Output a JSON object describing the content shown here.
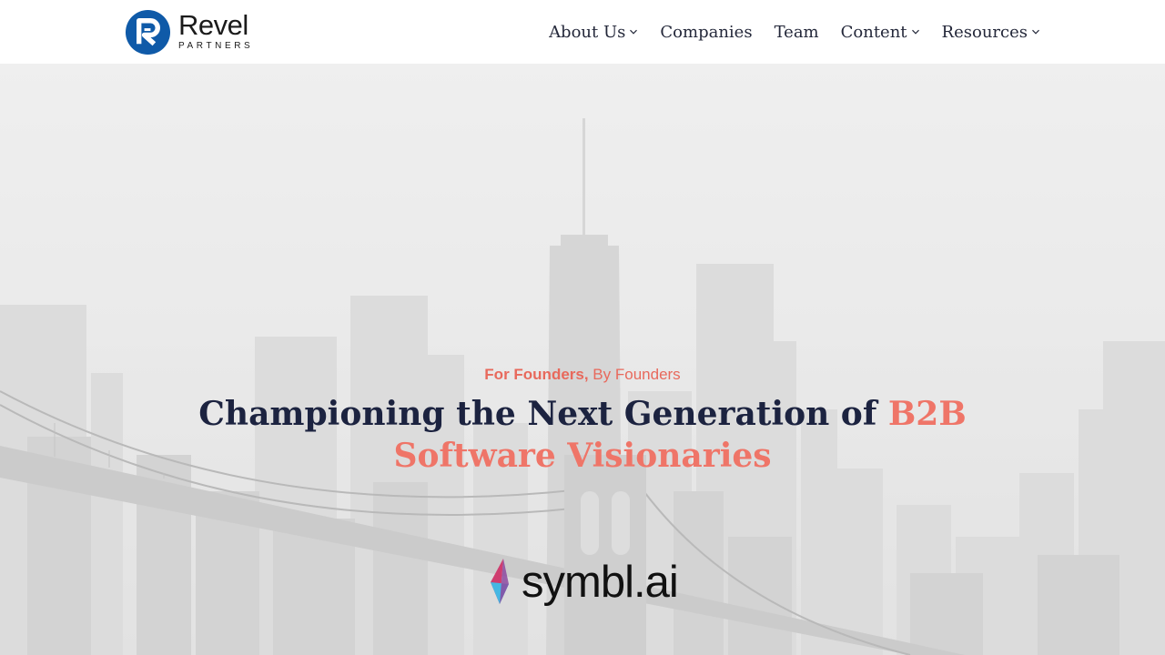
{
  "brand": {
    "name": "Revel",
    "sub": "PARTNERS",
    "colors": {
      "primary": "#0f5aa8",
      "accent": "#ef7568",
      "text": "#1c2340"
    }
  },
  "nav": {
    "items": [
      {
        "label": "About Us",
        "has_dropdown": true,
        "icon": "chevron-down-icon"
      },
      {
        "label": "Companies",
        "has_dropdown": false
      },
      {
        "label": "Team",
        "has_dropdown": false
      },
      {
        "label": "Content",
        "has_dropdown": true,
        "icon": "chevron-down-icon"
      },
      {
        "label": "Resources",
        "has_dropdown": true,
        "icon": "chevron-down-icon"
      }
    ]
  },
  "hero": {
    "eyebrow_bold": "For Founders,",
    "eyebrow_rest": " By Founders",
    "headline_main": "Championing the Next Generation of ",
    "headline_accent": "B2B Software Visionaries",
    "partner_logo_text": "symbl.ai"
  }
}
